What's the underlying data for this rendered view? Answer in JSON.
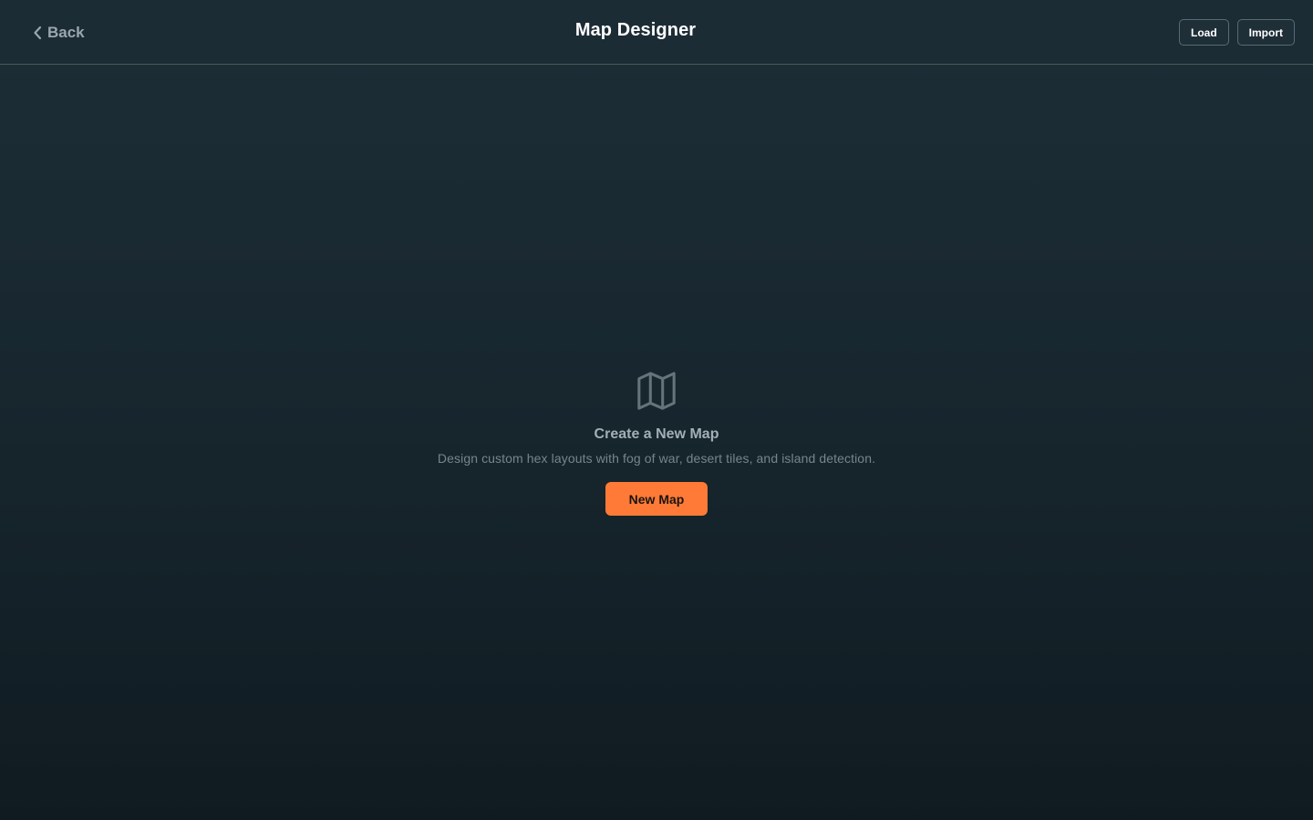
{
  "header": {
    "back_label": "Back",
    "title": "Map Designer",
    "load_label": "Load",
    "import_label": "Import"
  },
  "empty_state": {
    "icon": "map-icon",
    "title": "Create a New Map",
    "description": "Design custom hex layouts with fog of war, desert tiles, and island detection.",
    "button_label": "New Map"
  },
  "colors": {
    "accent": "#ff7a36",
    "background": "#18272f",
    "header_background": "#1c2c35"
  }
}
